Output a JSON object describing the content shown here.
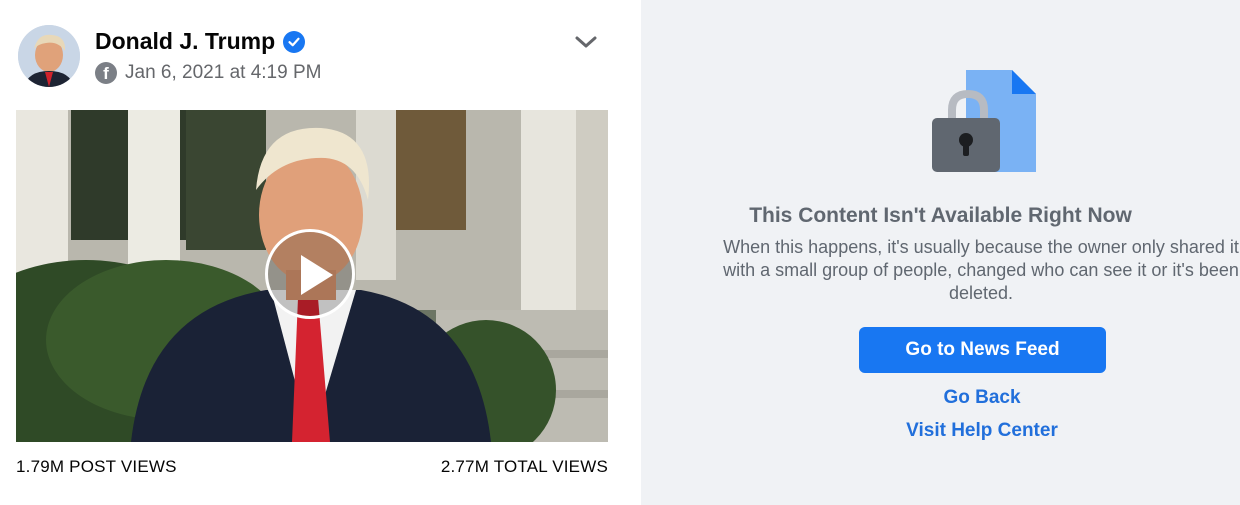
{
  "post": {
    "author": "Donald J. Trump",
    "timestamp": "Jan 6, 2021 at 4:19 PM",
    "post_views": "1.79M POST VIEWS",
    "total_views": "2.77M TOTAL VIEWS"
  },
  "unavailable": {
    "title": "This Content Isn't Available Right Now",
    "message": "When this happens, it's usually because the owner only shared it with a small group of people, changed who can see it or it's been deleted.",
    "primary_button": "Go to News Feed",
    "go_back": "Go Back",
    "help_center": "Visit Help Center"
  },
  "colors": {
    "facebook_blue": "#1877f2",
    "link_blue": "#216fdb",
    "panel_gray": "#f0f2f5"
  }
}
